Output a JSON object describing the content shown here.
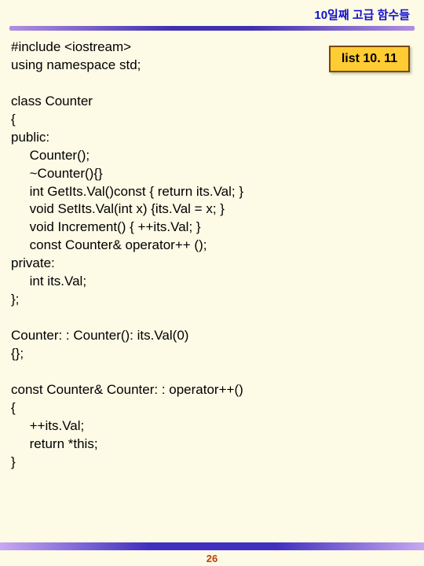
{
  "header": {
    "title": "10일째 고급 함수들"
  },
  "label": {
    "text": "list 10. 11"
  },
  "code": {
    "text": "#include <iostream>\nusing namespace std;\n\nclass Counter\n{\npublic:\n     Counter();\n     ~Counter(){}\n     int GetIts.Val()const { return its.Val; }\n     void SetIts.Val(int x) {its.Val = x; }\n     void Increment() { ++its.Val; }\n     const Counter& operator++ ();\nprivate:\n     int its.Val;\n};\n\nCounter: : Counter(): its.Val(0)\n{};\n\nconst Counter& Counter: : operator++()\n{\n     ++its.Val;\n     return *this;\n}"
  },
  "footer": {
    "page": "26"
  }
}
